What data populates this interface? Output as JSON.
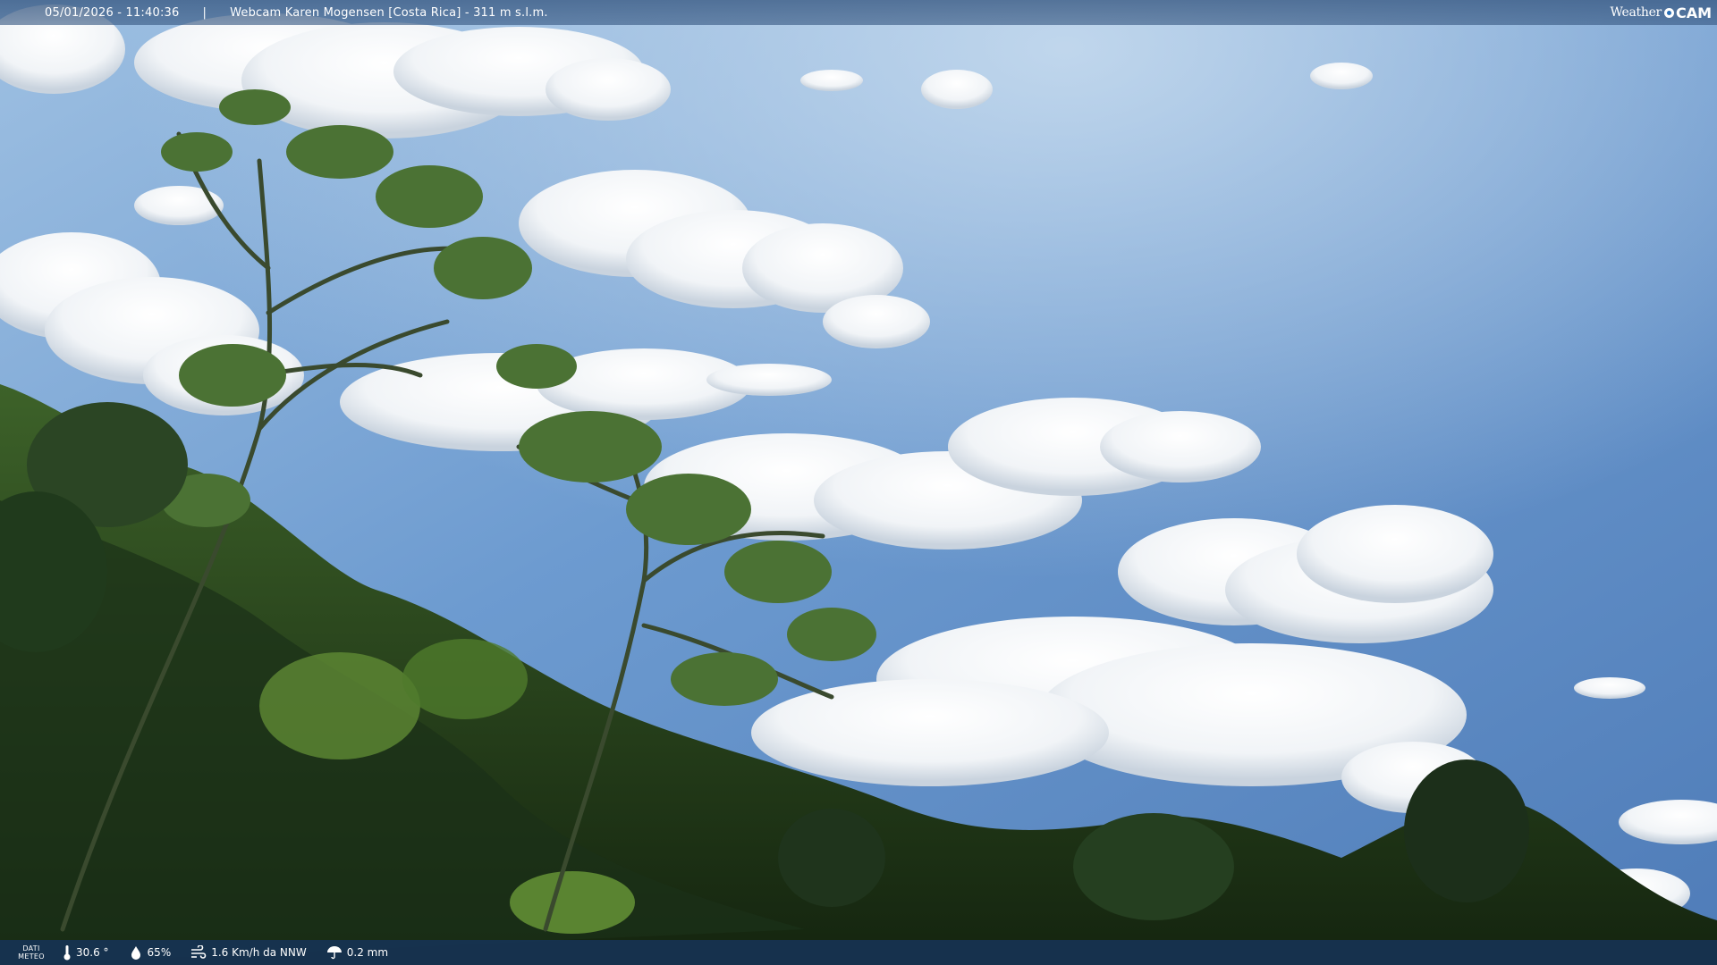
{
  "overlay": {
    "datetime": "05/01/2026 - 11:40:36",
    "separator": "|",
    "location": "Webcam Karen Mogensen [Costa Rica] - 311 m s.l.m.",
    "logo_weather": "Weather",
    "logo_cam": "CAM"
  },
  "meteo": {
    "label_line1": "DATI",
    "label_line2": "METEO",
    "temperature": "30.6 °",
    "humidity": "65%",
    "wind": "1.6 Km/h da NNW",
    "rain": "0.2 mm",
    "icons": [
      "thermometer-icon",
      "humidity-drop-icon",
      "wind-icon",
      "rain-umbrella-icon"
    ]
  },
  "colors": {
    "sky_top": "#8fb4dc",
    "sky_mid": "#5d8cc6",
    "bar_top": "#375882",
    "bar_bottom": "#163458",
    "foliage_dark": "#1f3a1c",
    "foliage_light": "#6f9a3a"
  }
}
